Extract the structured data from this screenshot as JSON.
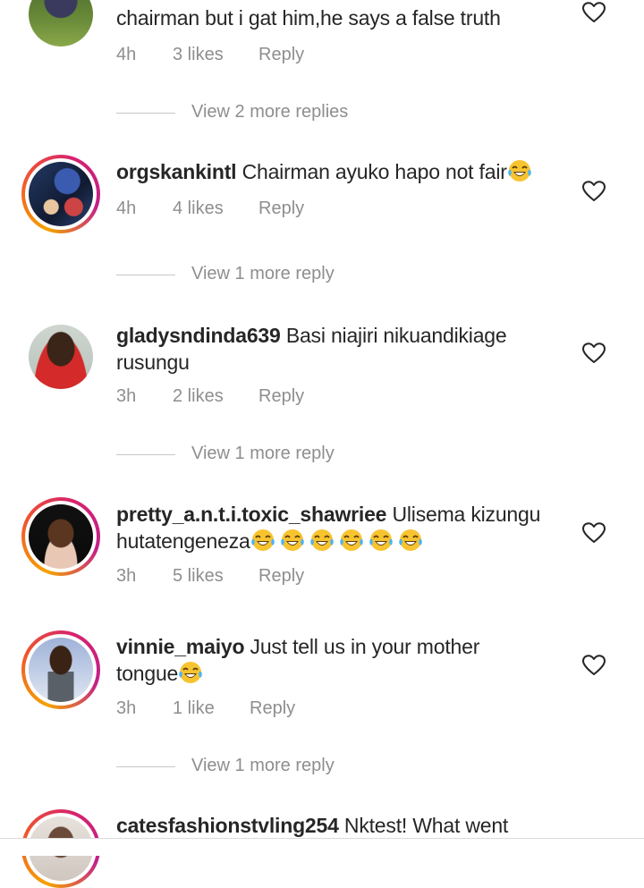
{
  "comments": [
    {
      "text": "chairman but i gat him,he says a false truth",
      "time": "4h",
      "likes": "3 likes",
      "reply": "Reply",
      "more_replies": "View 2 more replies"
    },
    {
      "username": "orgskankintl",
      "text": "Chairman ayuko hapo not fair",
      "time": "4h",
      "likes": "4 likes",
      "reply": "Reply",
      "more_replies": "View 1 more reply"
    },
    {
      "username": "gladysndinda639",
      "text_line1": "Basi niajiri nikuandikiage",
      "text_line2": "rusungu",
      "time": "3h",
      "likes": "2 likes",
      "reply": "Reply",
      "more_replies": "View 1 more reply"
    },
    {
      "username": "pretty_a.n.t.i.toxic_shawriee",
      "text_line1": "Ulisema kizungu",
      "text_line2": "hutatengeneza",
      "time": "3h",
      "likes": "5 likes",
      "reply": "Reply"
    },
    {
      "username": "vinnie_maiyo",
      "text_line1": "Just tell us in your mother",
      "text_line2": "tongue",
      "time": "3h",
      "likes": "1 like",
      "reply": "Reply",
      "more_replies": "View 1 more reply"
    },
    {
      "username": "catesfashionstvling254",
      "text": "Nktest! What went"
    }
  ],
  "icons": {
    "like": "heart-outline-icon",
    "emoji": "face-with-tears-of-joy-emoji"
  },
  "colors": {
    "text": "#262626",
    "secondary": "#8e8e8e",
    "story_ring_start": "#f5a300",
    "story_ring_end": "#c2208b"
  }
}
